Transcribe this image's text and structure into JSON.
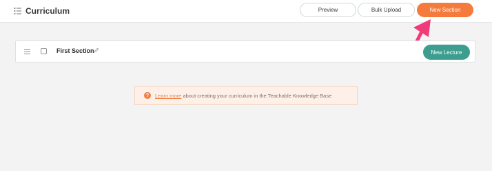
{
  "header": {
    "title": "Curriculum",
    "preview_label": "Preview",
    "bulk_upload_label": "Bulk Upload",
    "new_section_label": "New Section"
  },
  "section": {
    "title": "First Section",
    "new_lecture_label": "New Lecture"
  },
  "notice": {
    "link_text": "Learn more",
    "text": " about creating your curriculum in the Teachable Knowledge Base"
  },
  "colors": {
    "accent_orange": "#f47b3b",
    "accent_teal": "#3d9e8f",
    "annotation_pink": "#f13a7a"
  }
}
